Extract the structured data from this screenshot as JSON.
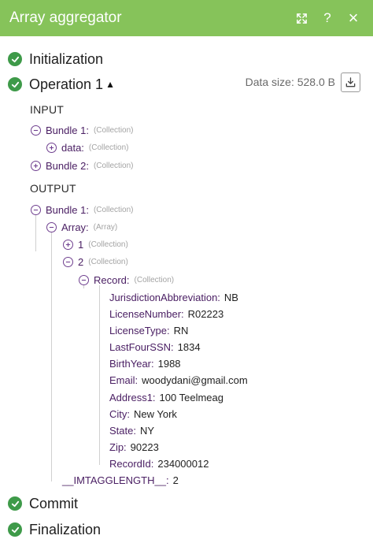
{
  "window": {
    "title": "Array aggregator",
    "help_label": "?",
    "close_label": "×"
  },
  "phases": {
    "initialization": "Initialization",
    "operation": "Operation 1",
    "commit": "Commit",
    "finalization": "Finalization"
  },
  "data_size": "Data size: 528.0 B",
  "input": {
    "title": "INPUT",
    "bundle1": {
      "key": "Bundle 1:",
      "type": "(Collection)"
    },
    "data": {
      "key": "data:",
      "type": "(Collection)"
    },
    "bundle2": {
      "key": "Bundle 2:",
      "type": "(Collection)"
    }
  },
  "output": {
    "title": "OUTPUT",
    "bundle1": {
      "key": "Bundle 1:",
      "type": "(Collection)"
    },
    "array": {
      "key": "Array:",
      "type": "(Array)"
    },
    "item1": {
      "key": "1",
      "type": "(Collection)"
    },
    "item2": {
      "key": "2",
      "type": "(Collection)"
    },
    "record": {
      "key": "Record:",
      "type": "(Collection)"
    },
    "fields": [
      {
        "key": "JurisdictionAbbreviation:",
        "value": "NB"
      },
      {
        "key": "LicenseNumber:",
        "value": "R02223"
      },
      {
        "key": "LicenseType:",
        "value": "RN"
      },
      {
        "key": "LastFourSSN:",
        "value": "1834"
      },
      {
        "key": "BirthYear:",
        "value": "1988"
      },
      {
        "key": "Email:",
        "value": "woodydani@gmail.com"
      },
      {
        "key": "Address1:",
        "value": "100 Teelmeag"
      },
      {
        "key": "City:",
        "value": "New York"
      },
      {
        "key": "State:",
        "value": "NY"
      },
      {
        "key": "Zip:",
        "value": "90223"
      },
      {
        "key": "RecordId:",
        "value": "234000012"
      }
    ],
    "agg_length": {
      "key": "__IMTAGGLENGTH__:",
      "value": "2"
    }
  }
}
